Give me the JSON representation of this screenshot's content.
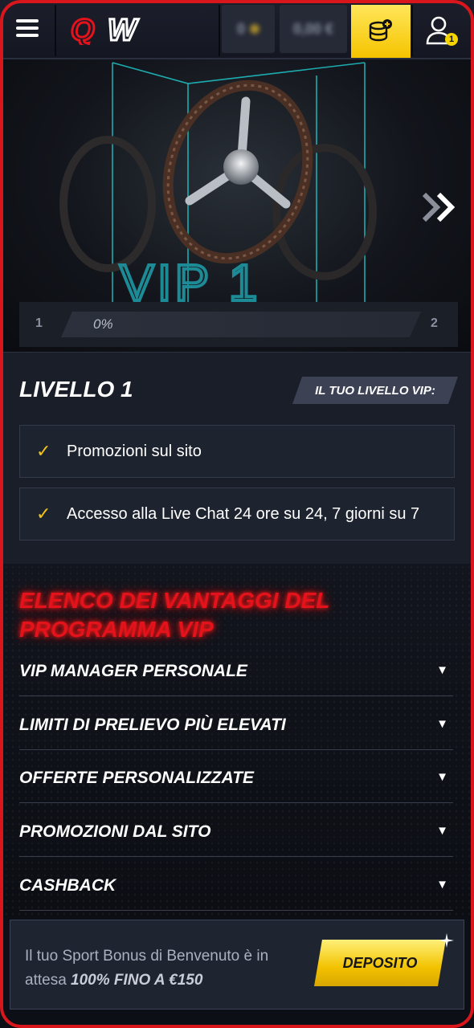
{
  "header": {
    "logo_text": "QW",
    "balance_1": "0",
    "balance_2": "0,00 €",
    "user_badge": "1"
  },
  "hero": {
    "level_sign": "VIP 1",
    "progress": {
      "from_level": "1",
      "to_level": "2",
      "percent_label": "0%",
      "value": 0
    }
  },
  "level": {
    "title": "LIVELLO 1",
    "tag": "IL TUO LIVELLO VIP:",
    "perks": [
      "Promozioni sul sito",
      "Accesso alla Live Chat 24 ore su 24, 7 giorni su 7"
    ]
  },
  "benefits": {
    "title": "ELENCO DEI VANTAGGI DEL PROGRAMMA VIP",
    "items": [
      "VIP MANAGER PERSONALE",
      "LIMITI DI PRELIEVO PIÙ ELEVATI",
      "OFFERTE PERSONALIZZATE",
      "PROMOZIONI DAL SITO",
      "CASHBACK"
    ]
  },
  "bonus_banner": {
    "text": "Il tuo Sport Bonus di Benvenuto è in attesa",
    "highlight": "100% FINO A €150",
    "button": "DEPOSITO"
  },
  "colors": {
    "accent_red": "#e3121b",
    "accent_yellow": "#f5c400",
    "check_yellow": "#f0c419"
  }
}
